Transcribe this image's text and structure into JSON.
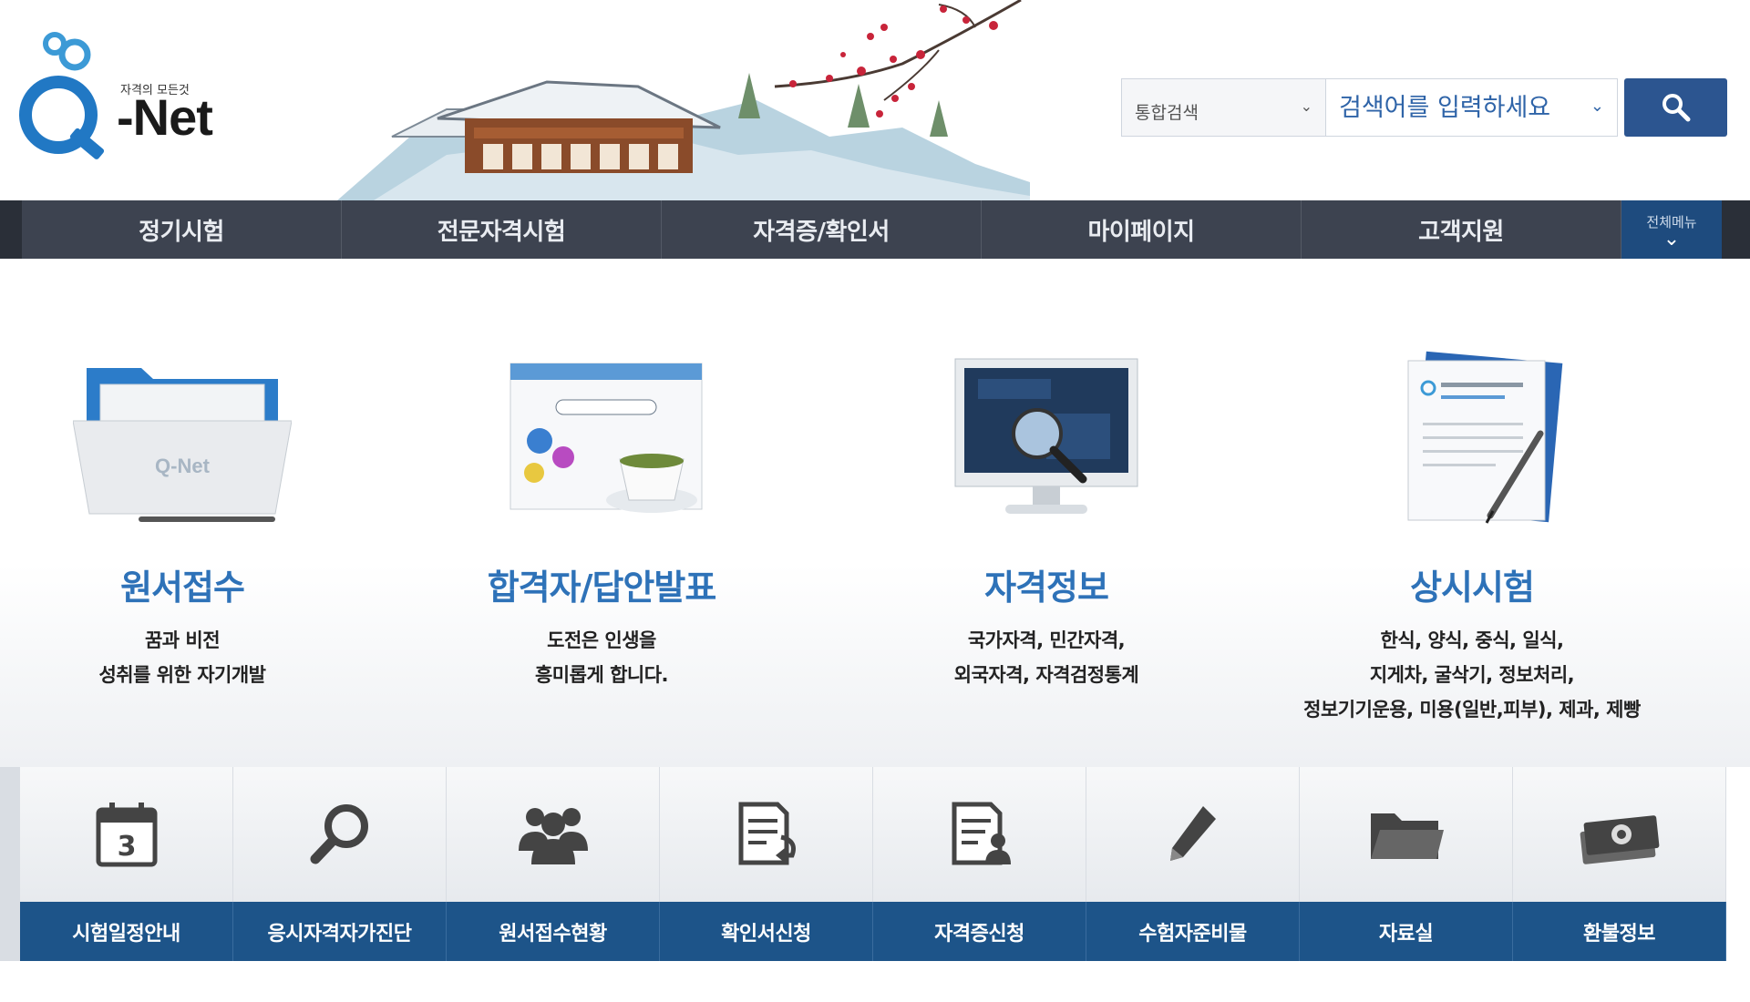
{
  "header": {
    "logo_tagline": "자격의 모든것",
    "logo_text": "-Net",
    "search": {
      "type_label": "통합검색",
      "placeholder": "검색어를 입력하세요"
    }
  },
  "nav": {
    "items": [
      "정기시험",
      "전문자격시험",
      "자격증/확인서",
      "마이페이지",
      "고객지원"
    ],
    "all_menu_label": "전체메뉴"
  },
  "features": [
    {
      "title": "원서접수",
      "desc": [
        "꿈과 비전",
        "성취를 위한 자기개발"
      ]
    },
    {
      "title": "합격자/답안발표",
      "desc": [
        "도전은 인생을",
        "흥미롭게 합니다."
      ]
    },
    {
      "title": "자격정보",
      "desc": [
        "국가자격, 민간자격,",
        "외국자격, 자격검정통계"
      ]
    },
    {
      "title": "상시시험",
      "desc": [
        "한식, 양식, 중식, 일식,",
        "지게차, 굴삭기, 정보처리,",
        "정보기기운용, 미용(일반,피부), 제과, 제빵"
      ]
    }
  ],
  "quick_menu": {
    "items": [
      "시험일정안내",
      "응시자격자가진단",
      "원서접수현황",
      "확인서신청",
      "자격증신청",
      "수험자준비물",
      "자료실",
      "환불정보"
    ],
    "calendar_day": "3"
  },
  "colors": {
    "brand_blue": "#2e72b8",
    "nav_dark": "#3d4350",
    "quick_bar": "#1d5489",
    "search_button": "#2c5590"
  }
}
